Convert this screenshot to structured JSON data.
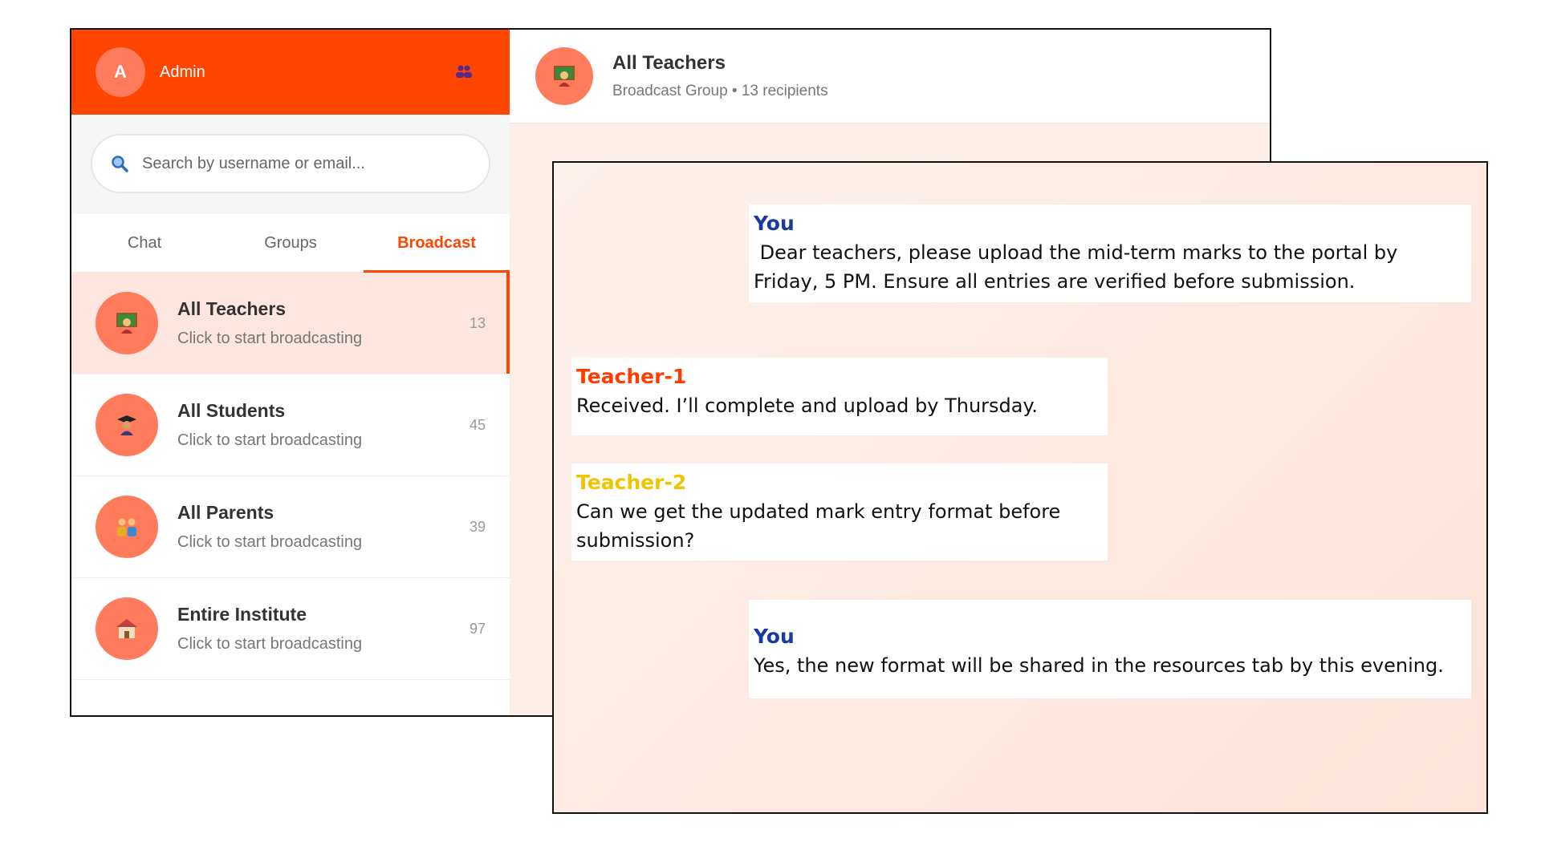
{
  "admin": {
    "initial": "A",
    "name": "Admin"
  },
  "search": {
    "placeholder": "Search by username or email..."
  },
  "tabs": [
    {
      "label": "Chat"
    },
    {
      "label": "Groups"
    },
    {
      "label": "Broadcast"
    }
  ],
  "broadcast_list": [
    {
      "title": "All Teachers",
      "subtitle": "Click to start broadcasting",
      "count": "13",
      "icon": "teacher-icon"
    },
    {
      "title": "All Students",
      "subtitle": "Click to start broadcasting",
      "count": "45",
      "icon": "student-icon"
    },
    {
      "title": "All Parents",
      "subtitle": "Click to start broadcasting",
      "count": "39",
      "icon": "parents-icon"
    },
    {
      "title": "Entire Institute",
      "subtitle": "Click to start broadcasting",
      "count": "97",
      "icon": "school-icon"
    }
  ],
  "chat_header": {
    "title": "All Teachers",
    "subtitle": "Broadcast Group • 13 recipients"
  },
  "messages": [
    {
      "sender": "You",
      "text": " Dear teachers, please upload the mid-term marks to the portal by Friday, 5 PM. Ensure all entries are verified before submission."
    },
    {
      "sender": "Teacher-1",
      "text": "Received. I’ll complete and upload by Thursday."
    },
    {
      "sender": "Teacher-2",
      "text": "Can we get the updated mark entry format before submission?"
    },
    {
      "sender": "You",
      "text": "Yes, the new format will be shared in the resources tab by this evening."
    }
  ],
  "colors": {
    "accent": "#ff4500",
    "you": "#1a3a9c",
    "teacher1": "#ff3d00",
    "teacher2": "#f0c400"
  }
}
